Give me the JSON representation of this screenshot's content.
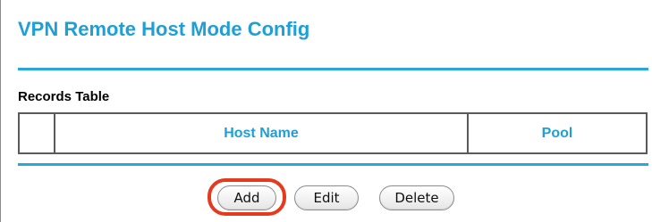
{
  "page": {
    "title": "VPN Remote Host Mode Config"
  },
  "records_table": {
    "label": "Records Table",
    "columns": [
      "",
      "Host Name",
      "Pool"
    ],
    "rows": []
  },
  "actions": {
    "add_label": "Add",
    "edit_label": "Edit",
    "delete_label": "Delete",
    "highlighted": "Add"
  },
  "colors": {
    "title": "#1e9fd6",
    "rule": "#27a7dc",
    "highlight_ring": "#e63a1e"
  }
}
